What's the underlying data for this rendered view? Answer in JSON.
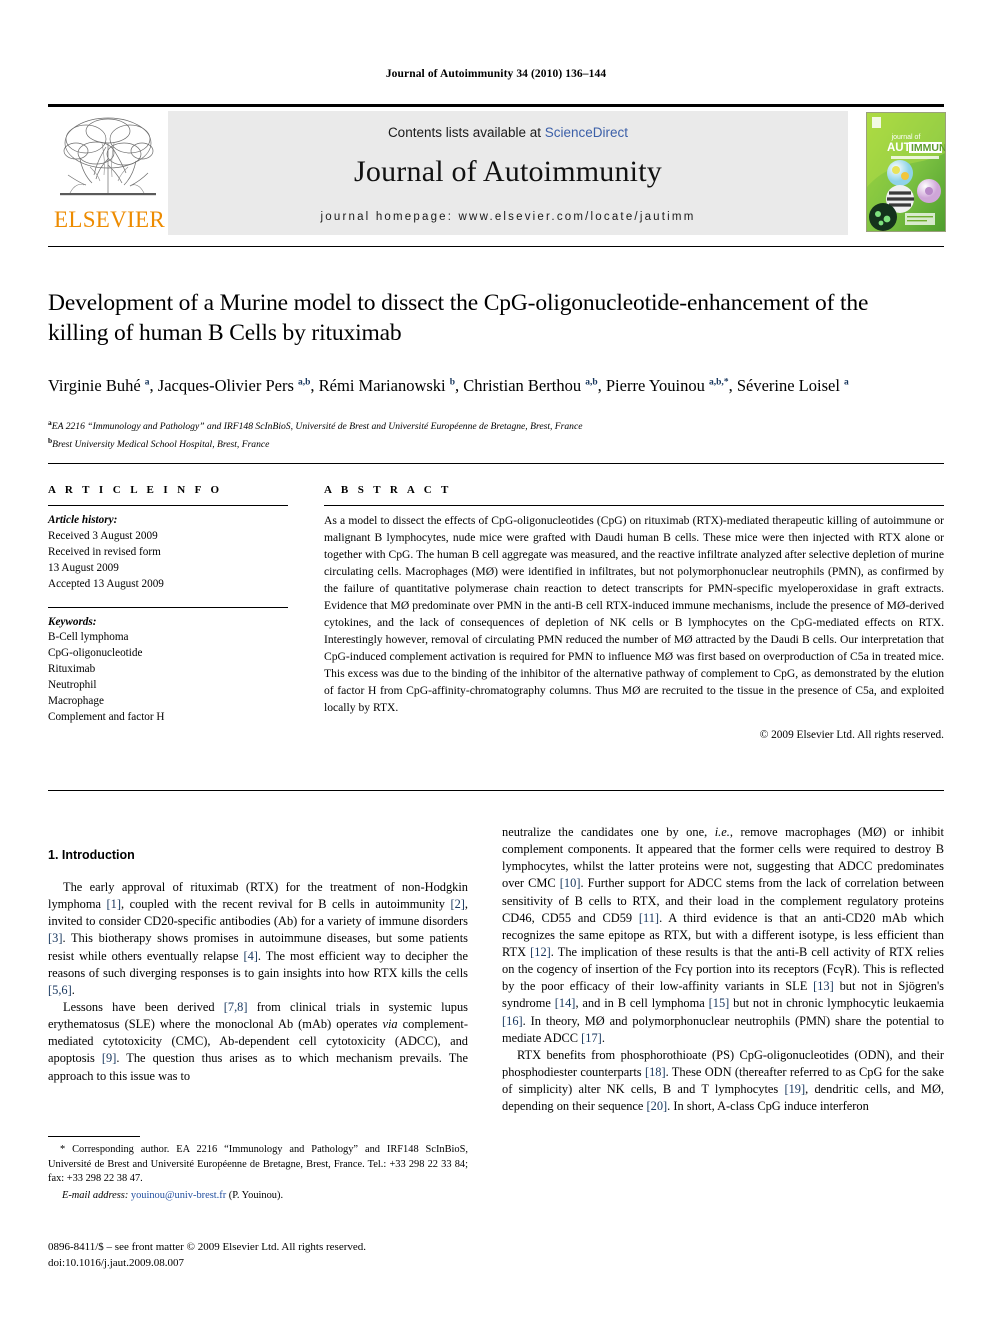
{
  "running_head": "Journal of Autoimmunity 34 (2010) 136–144",
  "masthead": {
    "publisher": "ELSEVIER",
    "contents_prefix": "Contents lists available at ",
    "contents_link": "ScienceDirect",
    "journal_title": "Journal of Autoimmunity",
    "homepage": "journal homepage: www.elsevier.com/locate/jautimm",
    "cover_line1": "journal of",
    "cover_line2": "AUTO",
    "cover_line3": "IMMUNITY"
  },
  "article": {
    "title": "Development of a Murine model to dissect the CpG-oligonucleotide-enhancement of the killing of human B Cells by rituximab",
    "authors_html": "Virginie Buhé <sup>a</sup>, Jacques-Olivier Pers <sup>a,b</sup>, Rémi Marianowski <sup>b</sup>, Christian Berthou <sup>a,b</sup>, Pierre Youinou <sup>a,b,</sup><sup>*</sup>, Séverine Loisel <sup>a</sup>",
    "affiliation_a": "EA 2216 “Immunology and Pathology” and IRF148 ScInBioS, Université de Brest and Université Européenne de Bretagne, Brest, France",
    "affiliation_b": "Brest University Medical School Hospital, Brest, France"
  },
  "info": {
    "heading": "A R T I C L E   I N F O",
    "history_label": "Article history:",
    "history": [
      "Received 3 August 2009",
      "Received in revised form",
      "13 August 2009",
      "Accepted 13 August 2009"
    ],
    "keywords_label": "Keywords:",
    "keywords": [
      "B-Cell lymphoma",
      "CpG-oligonucleotide",
      "Rituximab",
      "Neutrophil",
      "Macrophage",
      "Complement and factor H"
    ]
  },
  "abstract": {
    "heading": "A B S T R A C T",
    "text": "As a model to dissect the effects of CpG-oligonucleotides (CpG) on rituximab (RTX)-mediated therapeutic killing of autoimmune or malignant B lymphocytes, nude mice were grafted with Daudi human B cells. These mice were then injected with RTX alone or together with CpG. The human B cell aggregate was measured, and the reactive infiltrate analyzed after selective depletion of murine circulating cells. Macrophages (MØ) were identified in infiltrates, but not polymorphonuclear neutrophils (PMN), as confirmed by the failure of quantitative polymerase chain reaction to detect transcripts for PMN-specific myeloperoxidase in graft extracts. Evidence that MØ predominate over PMN in the anti-B cell RTX-induced immune mechanisms, include the presence of MØ-derived cytokines, and the lack of consequences of depletion of NK cells or B lymphocytes on the CpG-mediated effects on RTX. Interestingly however, removal of circulating PMN reduced the number of MØ attracted by the Daudi B cells. Our interpretation that CpG-induced complement activation is required for PMN to influence MØ was first based on overproduction of C5a in treated mice. This excess was due to the binding of the inhibitor of the alternative pathway of complement to CpG, as demonstrated by the elution of factor H from CpG-affinity-chromatography columns. Thus MØ are recruited to the tissue in the presence of C5a, and exploited locally by RTX.",
    "copyright": "© 2009 Elsevier Ltd. All rights reserved."
  },
  "body": {
    "section_heading": "1. Introduction",
    "left_p1_html": "The early approval of rituximab (RTX) for the treatment of non-Hodgkin lymphoma <span class=\"ref\">[1]</span>, coupled with the recent revival for B cells in autoimmunity <span class=\"ref\">[2]</span>, invited to consider CD20-specific antibodies (Ab) for a variety of immune disorders <span class=\"ref\">[3]</span>. This biotherapy shows promises in autoimmune diseases, but some patients resist while others eventually relapse <span class=\"ref\">[4]</span>. The most efficient way to decipher the reasons of such diverging responses is to gain insights into how RTX kills the cells <span class=\"ref\">[5,6]</span>.",
    "left_p2_html": "Lessons have been derived <span class=\"ref\">[7,8]</span> from clinical trials in systemic lupus erythematosus (SLE) where the monoclonal Ab (mAb) operates <span class=\"it\">via</span> complement-mediated cytotoxicity (CMC), Ab-dependent cell cytotoxicity (ADCC), and apoptosis <span class=\"ref\">[9]</span>. The question thus arises as to which mechanism prevails. The approach to this issue was to",
    "right_p1_html": "neutralize the candidates one by one, <span class=\"it\">i.e.</span>, remove macrophages (MØ) or inhibit complement components. It appeared that the former cells were required to destroy B lymphocytes, whilst the latter proteins were not, suggesting that ADCC predominates over CMC <span class=\"ref\">[10]</span>. Further support for ADCC stems from the lack of correlation between sensitivity of B cells to RTX, and their load in the complement regulatory proteins CD46, CD55 and CD59 <span class=\"ref\">[11]</span>. A third evidence is that an anti-CD20 mAb which recognizes the same epitope as RTX, but with a different isotype, is less efficient than RTX <span class=\"ref\">[12]</span>. The implication of these results is that the anti-B cell activity of RTX relies on the cogency of insertion of the Fcγ portion into its receptors (FcγR). This is reflected by the poor efficacy of their low-affinity variants in SLE <span class=\"ref\">[13]</span> but not in Sjögren's syndrome <span class=\"ref\">[14]</span>, and in B cell lymphoma <span class=\"ref\">[15]</span> but not in chronic lymphocytic leukaemia <span class=\"ref\">[16]</span>. In theory, MØ and polymorphonuclear neutrophils (PMN) share the potential to mediate ADCC <span class=\"ref\">[17]</span>.",
    "right_p2_html": "RTX benefits from phosphorothioate (PS) CpG-oligonucleotides (ODN), and their phosphodiester counterparts <span class=\"ref\">[18]</span>. These ODN (thereafter referred to as CpG for the sake of simplicity) alter NK cells, B and T lymphocytes <span class=\"ref\">[19]</span>, dendritic cells, and MØ, depending on their sequence <span class=\"ref\">[20]</span>. In short, A-class CpG induce interferon"
  },
  "footnote": {
    "corresponding_html": "* Corresponding author. EA 2216 “Immunology and Pathology” and IRF148 ScInBioS, Université de Brest and Université Européenne de Bretagne, Brest, France. Tel.: +33 298 22 33 84; fax: +33 298 22 38 47.",
    "email_label": "E-mail address:",
    "email": "youinou@univ-brest.fr",
    "email_owner": "(P. Youinou).",
    "issn_line": "0896-8411/$ – see front matter © 2009 Elsevier Ltd. All rights reserved.",
    "doi_line": "doi:10.1016/j.jaut.2009.08.007"
  },
  "colors": {
    "link": "#3b5fa8",
    "reference": "#17365d",
    "elsevier_orange": "#ED8B00",
    "panel_grey": "#eaeaea",
    "cover_green": "#8ec63f"
  }
}
